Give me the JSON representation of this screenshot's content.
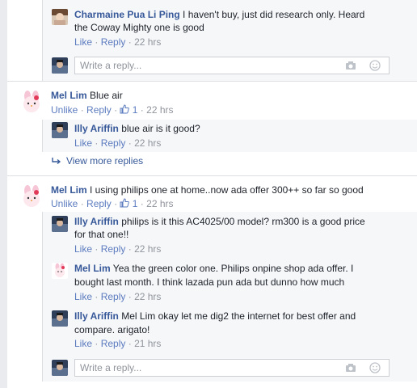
{
  "comments": [
    {
      "author": "Charmaine Pua Li Ping",
      "text_1": "I haven't buy, just did research only. Heard",
      "text_2": "the Coway Mighty one is good",
      "like": "Like",
      "reply": "Reply",
      "time": "22 hrs"
    },
    {
      "author": "Mel Lim",
      "text": "Blue air",
      "unlike": "Unlike",
      "reply": "Reply",
      "likes": "1",
      "time": "22 hrs",
      "replies": [
        {
          "author": "Illy Ariffin",
          "text": "blue air is it good?",
          "like": "Like",
          "reply": "Reply",
          "time": "22 hrs"
        }
      ],
      "view_more": "View more replies"
    },
    {
      "author": "Mel Lim",
      "text": "I using philips one at home..now ada offer 300++ so far so good",
      "unlike": "Unlike",
      "reply": "Reply",
      "likes": "1",
      "time": "22 hrs",
      "replies": [
        {
          "author": "Illy Ariffin",
          "text_1": "philips is it this AC4025/00 model? rm300 is a good price",
          "text_2": "for that one!!",
          "like": "Like",
          "reply": "Reply",
          "time": "22 hrs"
        },
        {
          "author": "Mel Lim",
          "text_1": "Yea the green color one. Philips onpine shop ada offer. I",
          "text_2": "bought last month. I think lazada pun ada but dunno how much",
          "like": "Like",
          "reply": "Reply",
          "time": "22 hrs"
        },
        {
          "author": "Illy Ariffin",
          "text_1": "Mel Lim okay let me dig2 the internet for best offer and",
          "text_2": "compare. arigato!",
          "like": "Like",
          "reply": "Reply",
          "time": "21 hrs"
        }
      ]
    }
  ],
  "reply_box": {
    "placeholder": "Write a reply..."
  },
  "icons": {
    "camera": "camera-icon",
    "emoji": "emoji-icon",
    "thumb": "thumbs-up-icon",
    "arrow": "reply-arrow-icon"
  },
  "colors": {
    "link": "#365899",
    "meta": "#90949c",
    "reply_bg": "#f6f7f9",
    "border": "#dddfe2"
  }
}
